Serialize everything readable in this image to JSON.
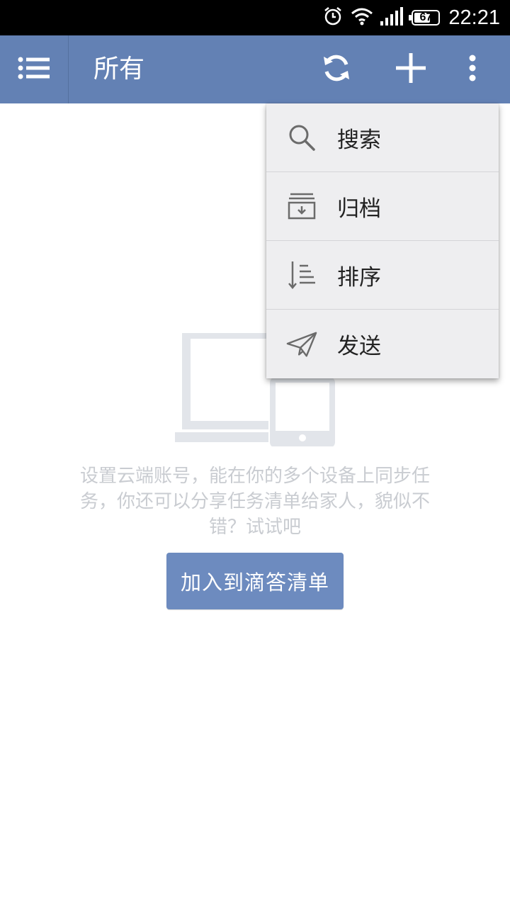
{
  "status_bar": {
    "time": "22:21",
    "battery": "67",
    "icons": [
      "alarm-icon",
      "wifi-icon",
      "signal-icon",
      "battery-icon"
    ]
  },
  "app_bar": {
    "title": "所有",
    "color": "#6381b4",
    "actions": [
      "menu-icon",
      "sync-icon",
      "add-icon",
      "overflow-icon"
    ]
  },
  "empty_state": {
    "message": "设置云端账号，能在你的多个设备上同步任务，你还可以分享任务清单给家人，貌似不错？试试吧",
    "button_label": "加入到滴答清单",
    "button_color": "#6d8bbf"
  },
  "popup_menu": {
    "items": [
      {
        "label": "搜索",
        "icon": "search-icon"
      },
      {
        "label": "归档",
        "icon": "archive-icon"
      },
      {
        "label": "排序",
        "icon": "sort-icon"
      },
      {
        "label": "发送",
        "icon": "send-icon"
      }
    ]
  }
}
